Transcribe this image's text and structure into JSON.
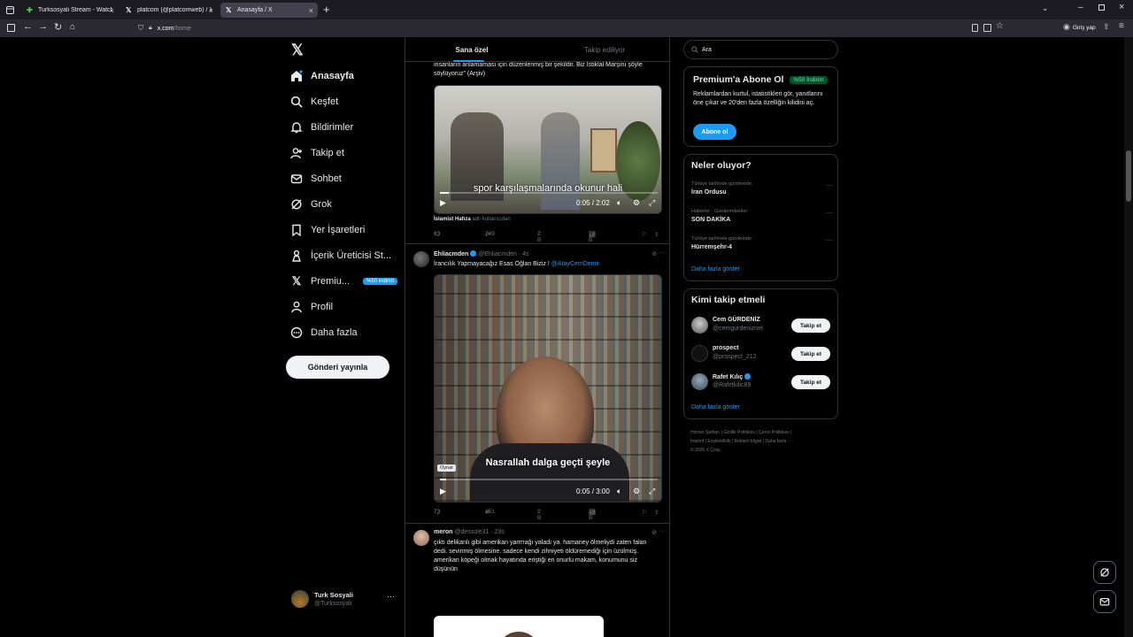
{
  "browser": {
    "tabs": [
      {
        "title": "Turksosyali Stream - Watch Live"
      },
      {
        "title": "platcom (@platcomweb) / X"
      },
      {
        "title": "Anasayfa / X"
      }
    ],
    "url_domain": "x.com",
    "url_path": "/home",
    "signin_label": "Giriş yap"
  },
  "nav": {
    "items": [
      {
        "label": "Anasayfa",
        "icon": "home-icon"
      },
      {
        "label": "Keşfet",
        "icon": "search-icon"
      },
      {
        "label": "Bildirimler",
        "icon": "bell-icon"
      },
      {
        "label": "Takip et",
        "icon": "add-person-icon"
      },
      {
        "label": "Sohbet",
        "icon": "mail-icon"
      },
      {
        "label": "Grok",
        "icon": "grok-icon"
      },
      {
        "label": "Yer İşaretleri",
        "icon": "bookmark-icon"
      },
      {
        "label": "İçerik Üreticisi St...",
        "icon": "creator-icon"
      },
      {
        "label": "Premiu...",
        "icon": "x-logo-icon"
      },
      {
        "label": "Profil",
        "icon": "person-icon"
      },
      {
        "label": "Daha fazla",
        "icon": "more-circle-icon"
      }
    ],
    "premium_badge": "%50 indirim",
    "post_button": "Gönderi yayınla",
    "account": {
      "name": "Turk Sosyali",
      "handle": "@Turksosyali"
    }
  },
  "feed": {
    "tabs": [
      "Sana özel",
      "Takip ediliyor"
    ],
    "post1": {
      "text": "insanların anlamaması için düzenlenmiş bir şekildir. Biz İstiklal Marşını şöyle söylüyoruz\" (Arşiv)",
      "caption": "spor karşılaşmalarında okunur hali",
      "time": "0:05 / 2:02",
      "credit": "İslamist Hafıza",
      "credit_suffix": "adlı kullanıcıdan",
      "stats": {
        "replies": "63",
        "reposts": "749",
        "likes": "2 B",
        "views": "74 B"
      }
    },
    "post2": {
      "name": "Ehliacmden",
      "handle": "@Ehliacmden",
      "age": "· 4s",
      "text": "İrancılık Yapmayacağız Esas Oğlan Biziz !",
      "overlay": "@AtayCemDemir",
      "caption": "Nasrallah dalga geçti şeyle",
      "tooltip": "Oynat",
      "time": "0:05 / 3:00",
      "stats": {
        "replies": "73",
        "reposts": "451",
        "likes": "2 B",
        "views": "30 B"
      }
    },
    "post3": {
      "name": "meron",
      "handle": "@dessole31",
      "age": "· 23s",
      "text": "çıktı delikanlı gibi amerikan yarrrrağı yaladı ya. hamaney ölmeliydi zaten falan dedi. sevinmiş ölmesine. sadece kendi zihniyeti öldüremediği için üzülmüş. amerikan köpeği olmak hayatında eriştiği en onurlu makam, konumunu siz düşünün"
    }
  },
  "right": {
    "search_placeholder": "Ara",
    "premium": {
      "title": "Premium'a Abone Ol",
      "badge": "%50 İndirim",
      "body": "Reklamlardan kurtul, istatistikleri gör, yanıtlarını öne çıkar ve 20'den fazla özelliğin kilidini aç.",
      "button": "Abone ol"
    },
    "trends": {
      "title": "Neler oluyor?",
      "items": [
        {
          "meta": "Türkiye tarihinde gündemde",
          "name": "İran Ordusu"
        },
        {
          "meta": "Haberler · Gündemdekiler",
          "name": "SON DAKİKA"
        },
        {
          "meta": "Türkiye tarihinde gündemde",
          "name": "Hürremşehr-4"
        }
      ],
      "more": "Daha fazla göster"
    },
    "who_to_follow": {
      "title": "Kimi takip etmeli",
      "items": [
        {
          "name": "Cem GÜRDENİZ",
          "handle": "@cemgurdeniznet",
          "button": "Takip et"
        },
        {
          "name": "prospect",
          "handle": "@prospect_212",
          "button": "Takip et"
        },
        {
          "name": "Rafet Kılıç",
          "handle": "@Rafetkilic89",
          "button": "Takip et"
        }
      ],
      "more": "Daha fazla göster"
    },
    "footer": {
      "line1": "Hizmet Şartları  |  Gizlilik Politikası  |  Çerez Politikası  |",
      "line2": "İmprint  |  Erişilebilirlik  |  Reklam bilgisi  |  Daha fazla ···",
      "line3": "© 2026 X Corp."
    }
  }
}
